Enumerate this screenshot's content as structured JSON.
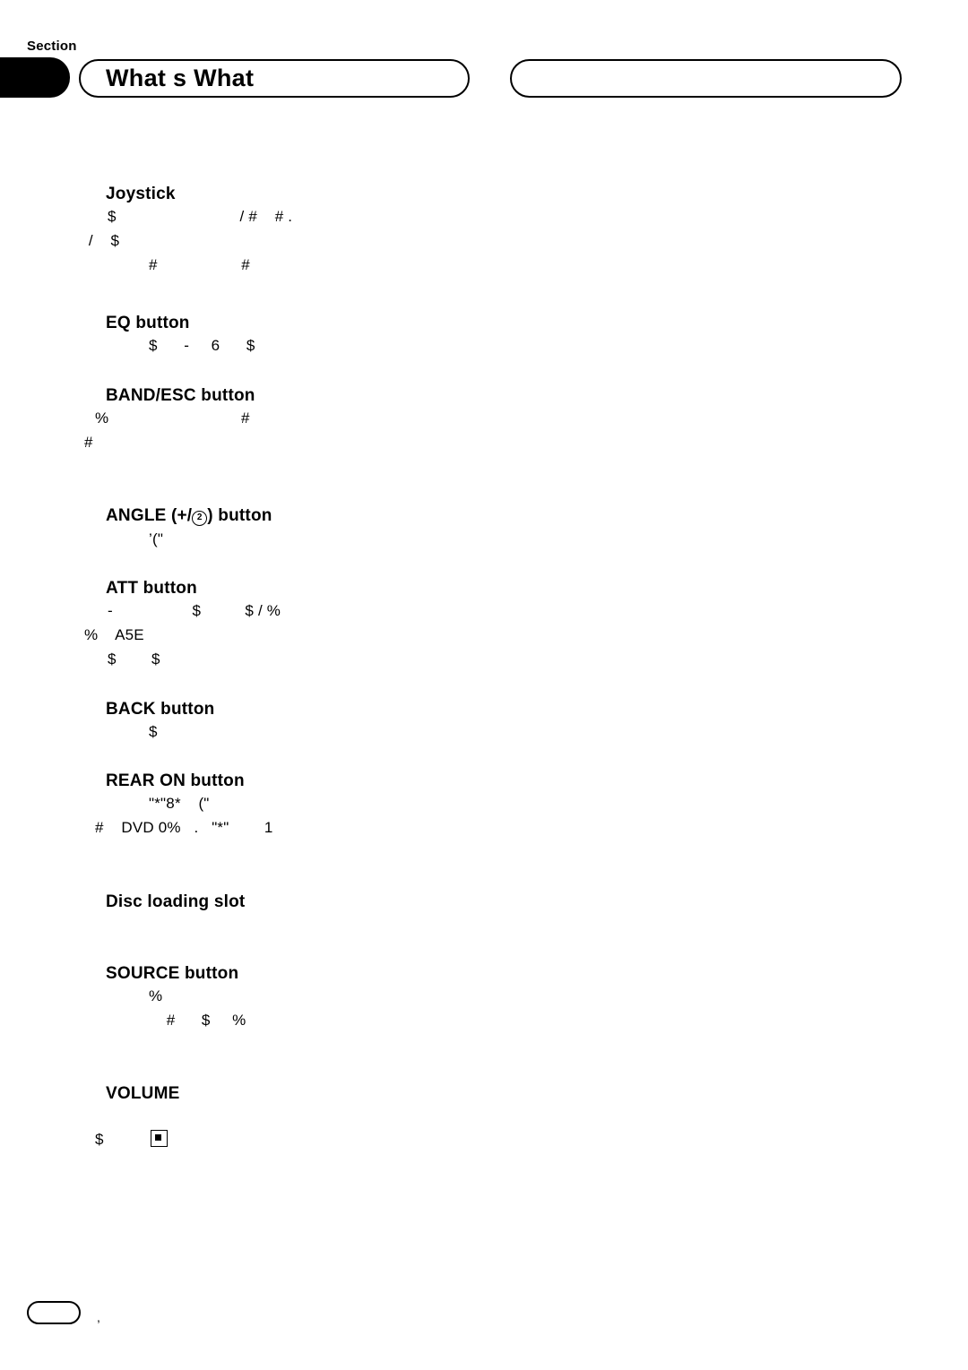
{
  "header": {
    "section_label": "Section",
    "title": "What s What",
    "right_pill_text": ""
  },
  "entries": [
    {
      "bullet": "",
      "title": "Joystick",
      "lines": [
        {
          "indent": "indent1",
          "text": "$                            / #    # ."
        },
        {
          "indent": "indentneg",
          "text": " /    $"
        },
        {
          "indent": "indent3",
          "text": "#                   #"
        }
      ]
    },
    {
      "bullet": "",
      "title": "EQ button",
      "lines": [
        {
          "indent": "indent3",
          "text": "$      -     6      $"
        }
      ]
    },
    {
      "bullet": "",
      "title": "BAND/ESC button",
      "lines": [
        {
          "indent": "indent1",
          "text": ""
        },
        {
          "indent": "indent0",
          "text": "%                              #"
        },
        {
          "indent": "indentneg",
          "text": "#"
        }
      ]
    },
    {
      "bullet": "",
      "title_parts": {
        "pre": "ANGLE (+/",
        "circle": "2",
        "post": ") button"
      },
      "lines": [
        {
          "indent": "indent3",
          "text": "’(\""
        }
      ]
    },
    {
      "bullet": "",
      "title": "ATT button",
      "lines": [
        {
          "indent": "indent1",
          "text": "-                  $          $ / %"
        },
        {
          "indent": "indentneg",
          "text": "%    A5E"
        },
        {
          "indent": "indent1",
          "text": "$        $"
        }
      ]
    },
    {
      "bullet": "",
      "title": "BACK button",
      "lines": [
        {
          "indent": "indent3",
          "text": "$"
        }
      ]
    },
    {
      "bullet": "",
      "title": "REAR ON button",
      "lines": [
        {
          "indent": "indent3",
          "text": "\"*\"8*    (\""
        },
        {
          "indent": "indent0",
          "text": "#    DVD 0%   .   \"*\"        1"
        },
        {
          "indent": "indent1",
          "text": ""
        }
      ]
    },
    {
      "bullet": "",
      "title": "Disc loading slot",
      "lines": [
        {
          "indent": "indent1",
          "text": ""
        }
      ]
    },
    {
      "bullet": "",
      "title": "SOURCE button",
      "lines": [
        {
          "indent": "indent3",
          "text": "%"
        },
        {
          "indent": "indent3",
          "text": "    #      $     %"
        },
        {
          "indent": "indent1",
          "text": ""
        }
      ]
    },
    {
      "bullet": "",
      "title": "VOLUME",
      "lines": []
    }
  ],
  "volume_line": {
    "prefix": "$",
    "has_square_icon": true
  },
  "footer": {
    "page_marker": "",
    "note": ","
  }
}
